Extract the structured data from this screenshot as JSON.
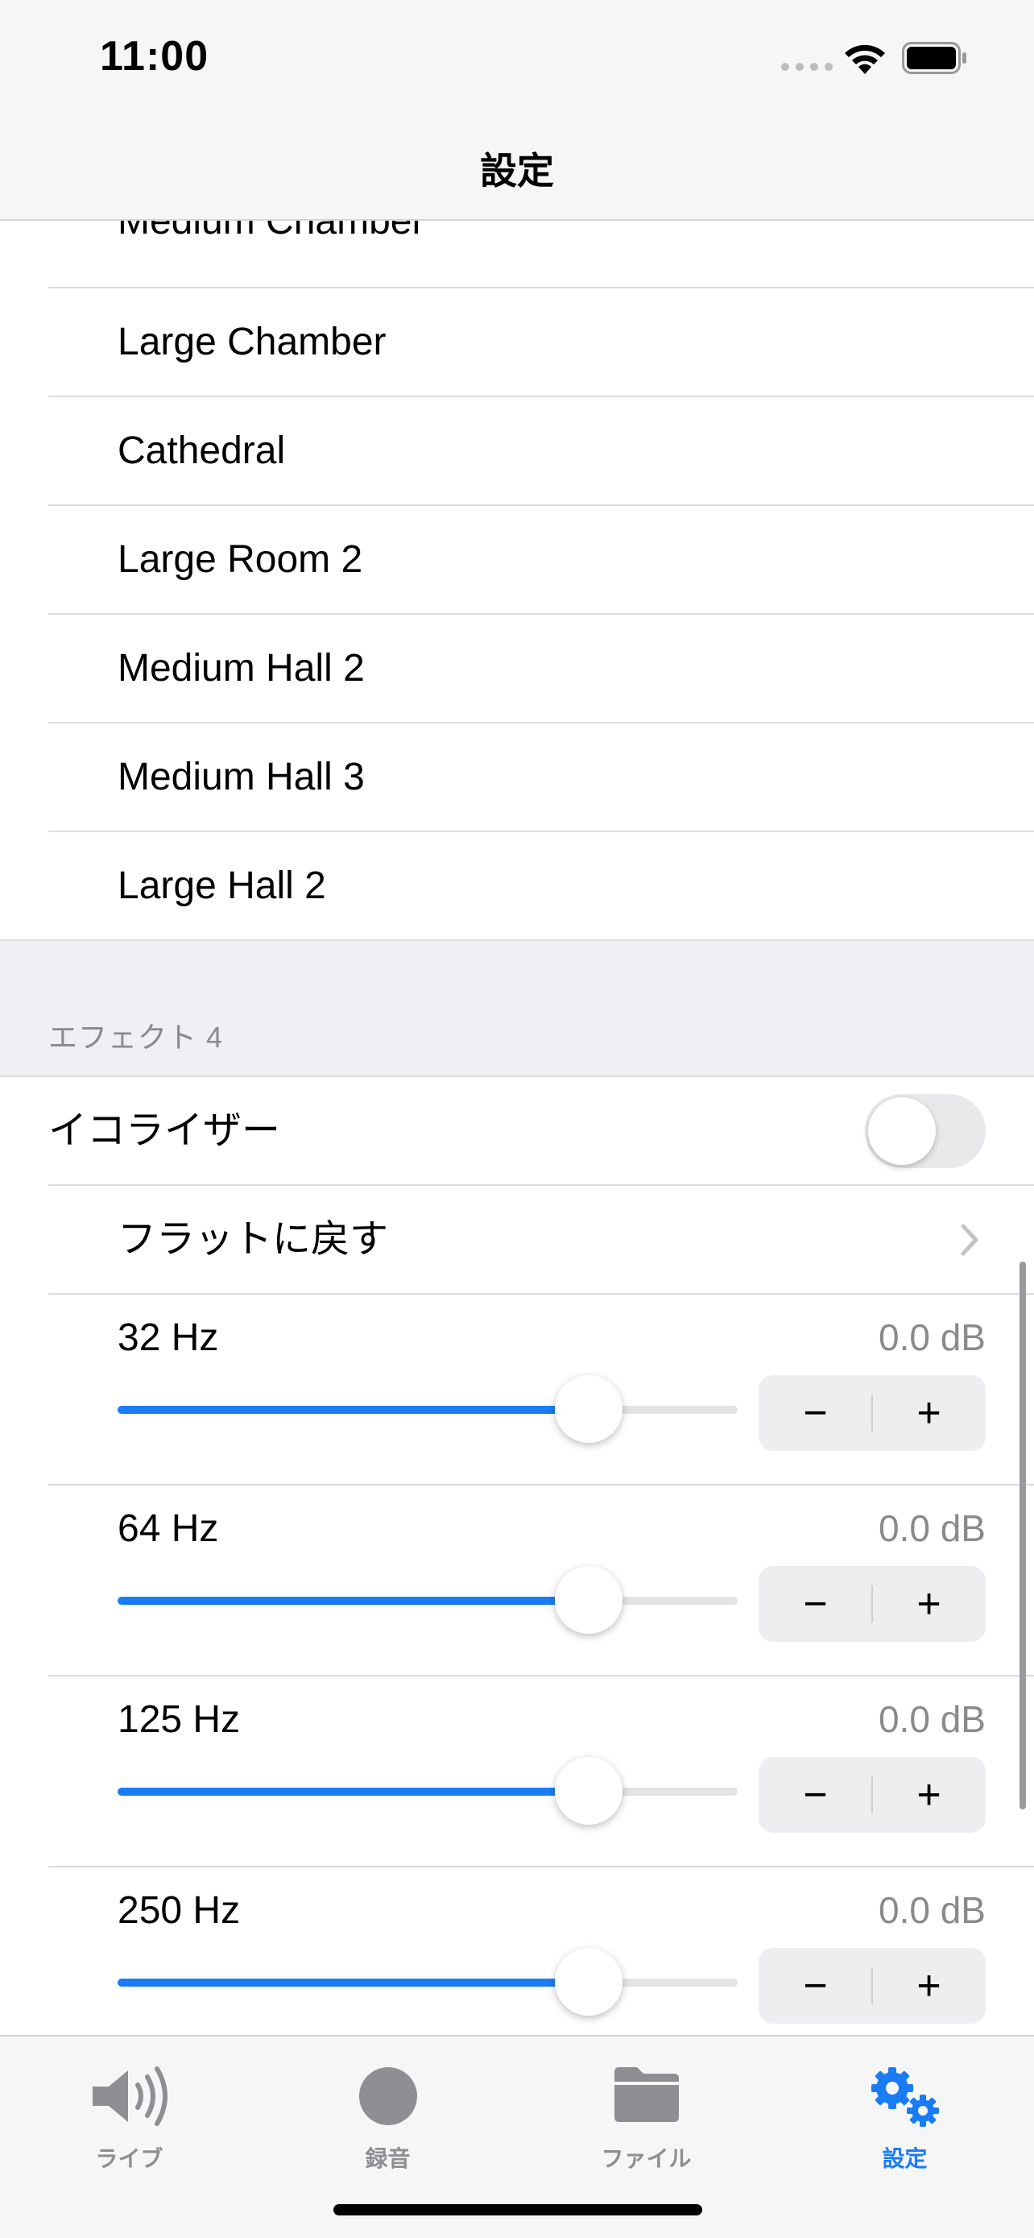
{
  "status_bar": {
    "time": "11:00"
  },
  "nav": {
    "title": "設定"
  },
  "reverb_presets": [
    "Medium Chamber",
    "Large Chamber",
    "Cathedral",
    "Large Room 2",
    "Medium Hall 2",
    "Medium Hall 3",
    "Large Hall 2"
  ],
  "effect4": {
    "header": "エフェクト 4",
    "equalizer_label": "イコライザー",
    "equalizer_on": false,
    "reset_label": "フラットに戻す",
    "bands": [
      {
        "label": "32 Hz",
        "value": "0.0 dB",
        "level": 0.76
      },
      {
        "label": "64 Hz",
        "value": "0.0 dB",
        "level": 0.76
      },
      {
        "label": "125 Hz",
        "value": "0.0 dB",
        "level": 0.76
      },
      {
        "label": "250 Hz",
        "value": "0.0 dB",
        "level": 0.76
      }
    ],
    "stepper": {
      "minus": "−",
      "plus": "+"
    }
  },
  "tabs": [
    {
      "label": "ライブ",
      "icon": "speaker-icon",
      "active": false
    },
    {
      "label": "録音",
      "icon": "record-icon",
      "active": false
    },
    {
      "label": "ファイル",
      "icon": "folder-icon",
      "active": false
    },
    {
      "label": "設定",
      "icon": "gears-icon",
      "active": true
    }
  ],
  "colors": {
    "accent": "#1a7cf5",
    "inactive": "#8e8e93",
    "background": "#efeff4"
  }
}
